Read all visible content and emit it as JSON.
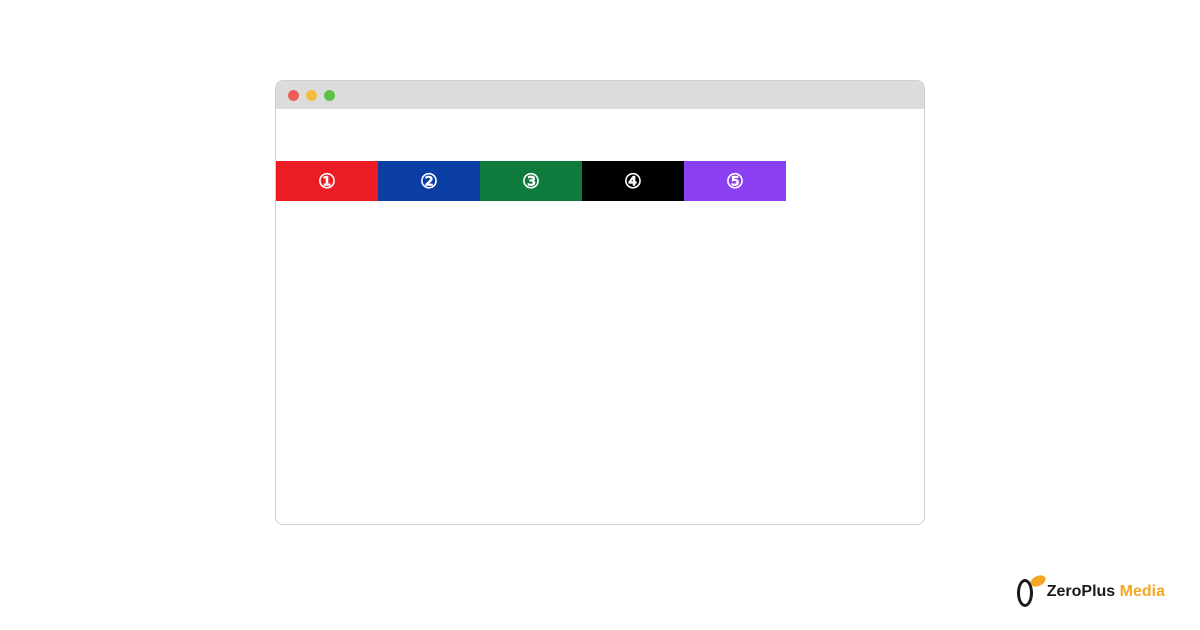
{
  "blocks": [
    {
      "label": "①",
      "color": "#ec1c24"
    },
    {
      "label": "②",
      "color": "#0b3ea5"
    },
    {
      "label": "③",
      "color": "#0e7a3c"
    },
    {
      "label": "④",
      "color": "#000000"
    },
    {
      "label": "⑤",
      "color": "#8a3ff0"
    }
  ],
  "watermark": {
    "brand": "ZeroPlus",
    "suffix": "Media"
  }
}
